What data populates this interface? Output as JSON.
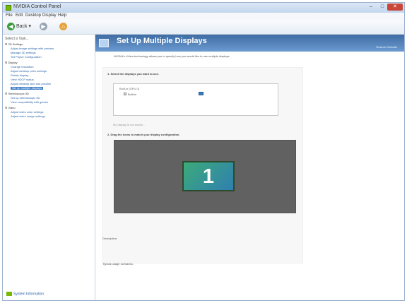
{
  "window": {
    "title": "NVIDIA Control Panel",
    "controls": {
      "minimize": "–",
      "maximize": "□",
      "close": "✕"
    }
  },
  "menu": [
    "File",
    "Edit",
    "Desktop",
    "Display",
    "Help"
  ],
  "toolbar": {
    "back_label": "Back",
    "back_arrow": "▾",
    "forward_icon": "forward-icon",
    "home_icon": "home-icon"
  },
  "sidebar": {
    "header": "Select a Task...",
    "items": [
      {
        "label": "⊟ 3D Settings",
        "type": "category"
      },
      {
        "label": "Adjust image settings with preview",
        "type": "task"
      },
      {
        "label": "Manage 3D settings",
        "type": "task"
      },
      {
        "label": "Set PhysX Configuration",
        "type": "task"
      },
      {
        "label": "⊟ Display",
        "type": "category"
      },
      {
        "label": "Change resolution",
        "type": "task"
      },
      {
        "label": "Adjust desktop color settings",
        "type": "task"
      },
      {
        "label": "Rotate display",
        "type": "task"
      },
      {
        "label": "View HDCP status",
        "type": "task"
      },
      {
        "label": "Adjust desktop size and position",
        "type": "task"
      },
      {
        "label": "Set up multiple displays",
        "type": "task",
        "selected": true
      },
      {
        "label": "⊟ Stereoscopic 3D",
        "type": "category"
      },
      {
        "label": "Set up stereoscopic 3D",
        "type": "task"
      },
      {
        "label": "View compatibility with games",
        "type": "task"
      },
      {
        "label": "⊟ Video",
        "type": "category"
      },
      {
        "label": "Adjust video color settings",
        "type": "task"
      },
      {
        "label": "Adjust video image settings",
        "type": "task"
      }
    ],
    "system_info": "System Information"
  },
  "content": {
    "title": "Set Up Multiple Displays",
    "restore_defaults": "Restore Defaults",
    "description": "NVIDIA's nView technology allows you to specify how you would like to use multiple displays.",
    "section1": {
      "title": "1. Select the displays you want to use.",
      "group_label": "Built-in (GPU 0)",
      "display_name": "Built-in",
      "display_checked": true,
      "note": "My display is not shown..."
    },
    "section2": {
      "title": "2. Drag the icons to match your display configuration."
    },
    "monitor_number": "1",
    "footer": {
      "description_label": "Description:",
      "typical_usage_label": "Typical usage scenarios:"
    }
  }
}
